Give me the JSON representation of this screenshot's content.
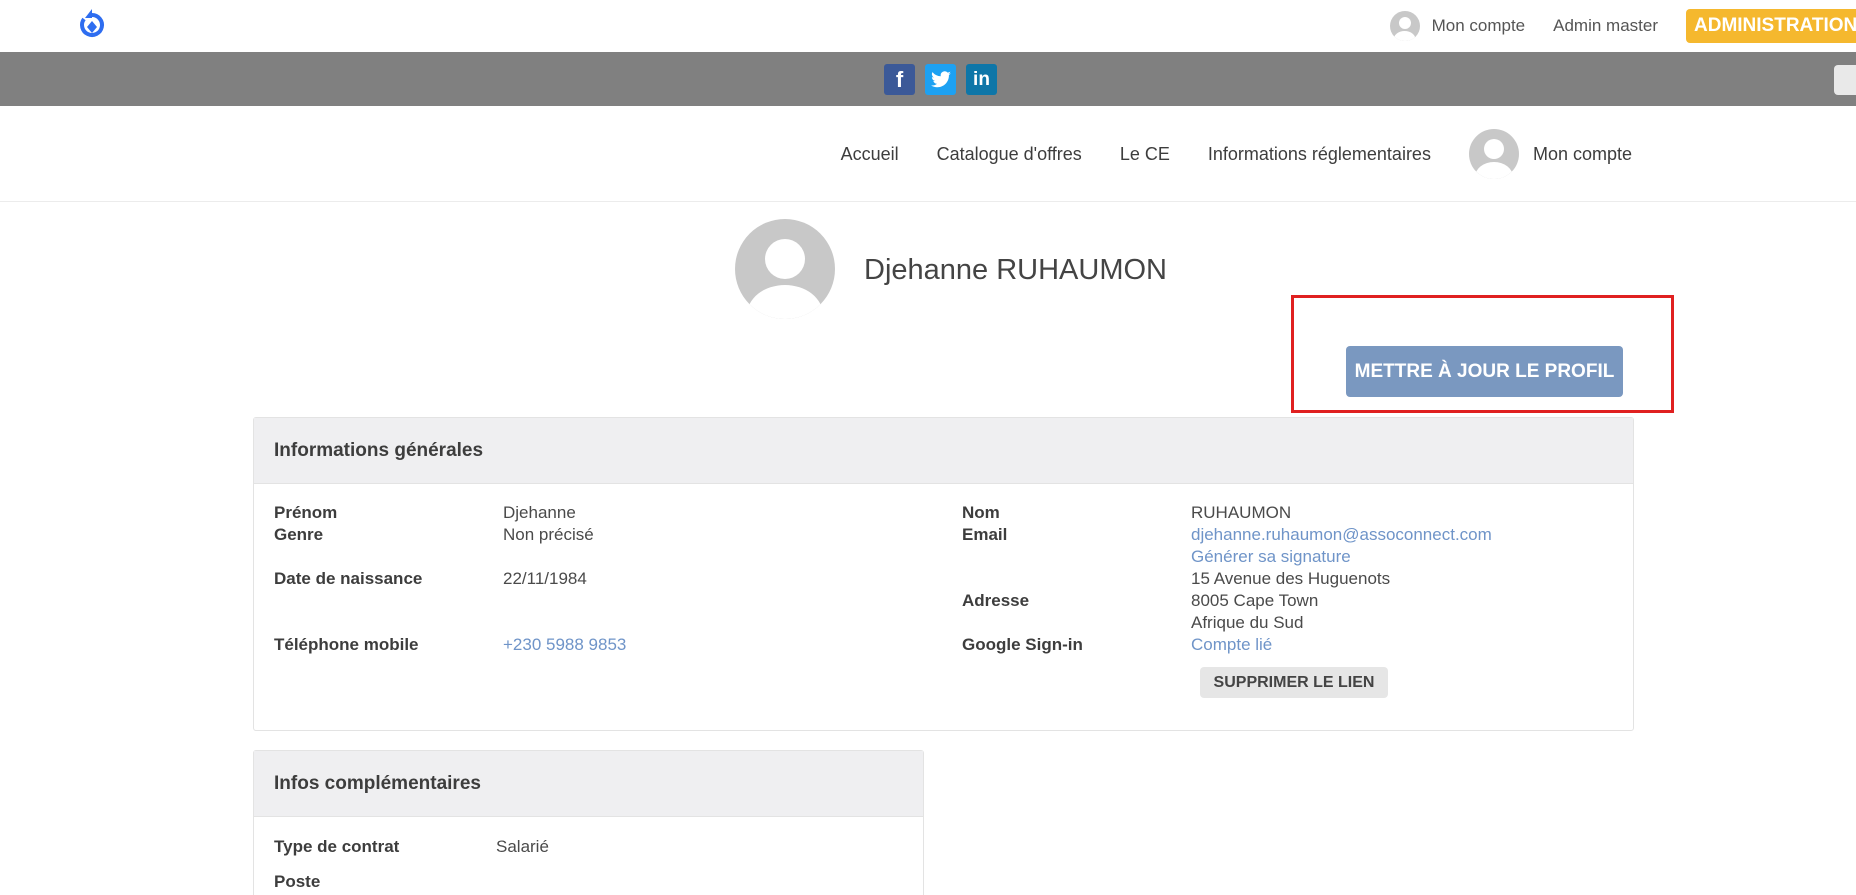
{
  "topbar": {
    "account_label": "Mon compte",
    "admin_user": "Admin master",
    "admin_button": "ADMINISTRATION"
  },
  "social": {
    "icons": [
      "facebook-icon",
      "twitter-icon",
      "linkedin-icon"
    ]
  },
  "nav": {
    "items": [
      "Accueil",
      "Catalogue d'offres",
      "Le CE",
      "Informations réglementaires"
    ],
    "account_label": "Mon compte"
  },
  "profile": {
    "name": "Djehanne RUHAUMON",
    "update_button": "METTRE À JOUR LE PROFIL"
  },
  "general": {
    "title": "Informations générales",
    "prenom_label": "Prénom",
    "prenom": "Djehanne",
    "genre_label": "Genre",
    "genre": "Non précisé",
    "naissance_label": "Date de naissance",
    "naissance": "22/11/1984",
    "telephone_label": "Téléphone mobile",
    "telephone": "+230 5988 9853",
    "nom_label": "Nom",
    "nom": "RUHAUMON",
    "email_label": "Email",
    "email": "djehanne.ruhaumon@assoconnect.com",
    "signature_link": "Générer sa signature",
    "adresse_label": "Adresse",
    "adresse_line1": "15 Avenue des Huguenots",
    "adresse_line2": "8005 Cape Town",
    "adresse_line3": "Afrique du Sud",
    "google_label": "Google Sign-in",
    "google_value": "Compte lié",
    "remove_link_button": "SUPPRIMER LE LIEN"
  },
  "extra": {
    "title": "Infos complémentaires",
    "contrat_label": "Type de contrat",
    "contrat": "Salarié",
    "poste_label": "Poste"
  },
  "colors": {
    "accent": "#f5b82e",
    "primary_button": "#7a98c0",
    "link": "#6f94c8",
    "highlight_border": "#e02020"
  }
}
